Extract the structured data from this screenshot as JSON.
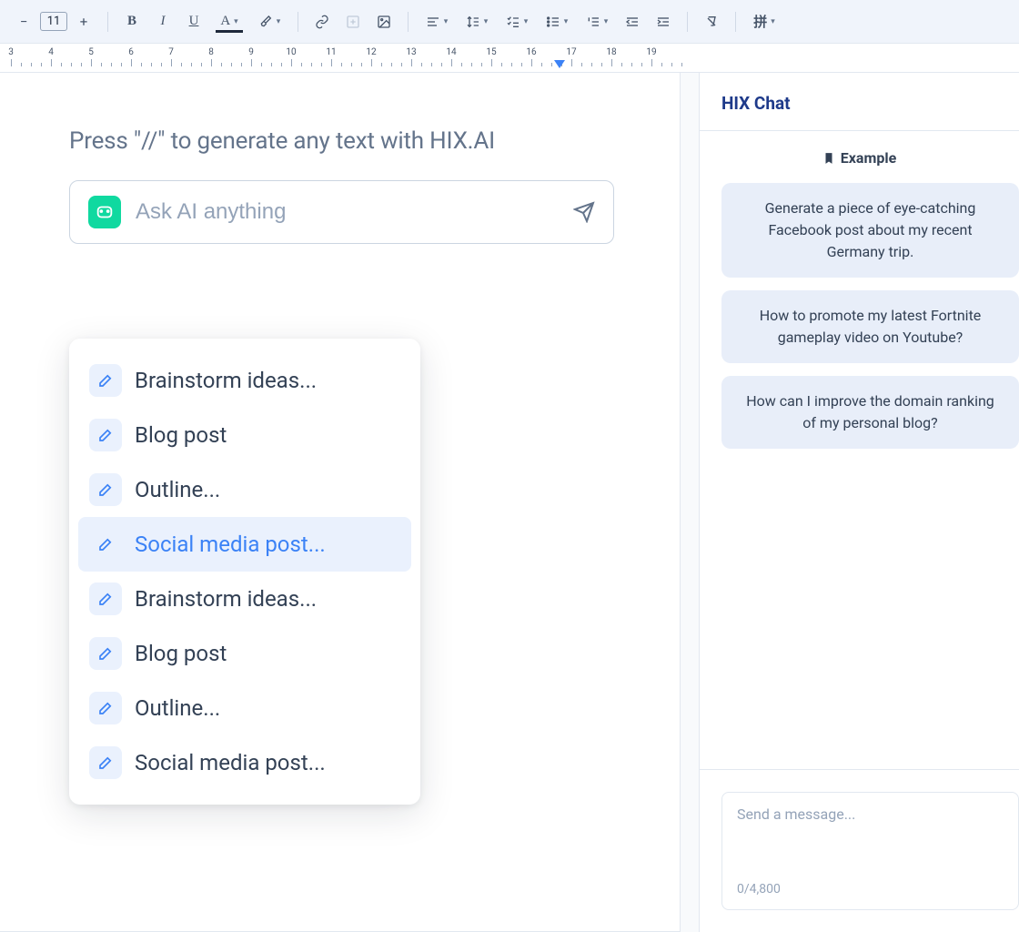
{
  "toolbar": {
    "font_size": "11",
    "pinyin_label": "拼"
  },
  "ruler": {
    "start": 3,
    "end": 19,
    "marker_pos": 16.7
  },
  "editor": {
    "hint": "Press  \"//\"  to generate any text with HIX.AI",
    "ai_placeholder": "Ask AI anything",
    "dropdown": [
      {
        "label": "Brainstorm ideas...",
        "active": false
      },
      {
        "label": "Blog post",
        "active": false
      },
      {
        "label": "Outline...",
        "active": false
      },
      {
        "label": "Social media post...",
        "active": true
      },
      {
        "label": "Brainstorm ideas...",
        "active": false
      },
      {
        "label": "Blog post",
        "active": false
      },
      {
        "label": "Outline...",
        "active": false
      },
      {
        "label": "Social media post...",
        "active": false
      }
    ]
  },
  "chat": {
    "title": "HIX Chat",
    "example_label": "Example",
    "examples": [
      "Generate a piece of eye-catching Facebook post about my recent Germany trip.",
      "How to promote my latest Fortnite gameplay video on Youtube?",
      "How can I improve the domain ranking of my personal blog?"
    ],
    "input_placeholder": "Send a message...",
    "char_count": "0/4,800"
  }
}
